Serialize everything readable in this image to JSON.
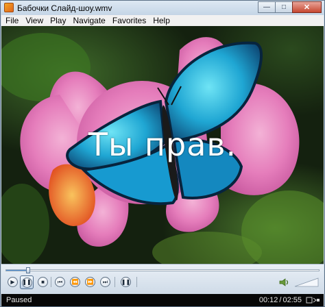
{
  "window": {
    "title": "Бабочки Слайд-шоу.wmv"
  },
  "menu": [
    "File",
    "View",
    "Play",
    "Navigate",
    "Favorites",
    "Help"
  ],
  "video": {
    "subtitle": "Ты прав."
  },
  "player": {
    "seek_progress_fraction": 0.07,
    "buttons": [
      "shuffle",
      "repeat",
      "stop",
      "previous",
      "rewind",
      "fast-forward",
      "next",
      "play-pause"
    ],
    "state_button": "pause",
    "volume_fraction": 0.0
  },
  "status": {
    "state": "Paused",
    "current_time": "00:12",
    "total_time": "02:55",
    "separator": "/"
  },
  "colors": {
    "status_bar": "#070707",
    "seek_fill": "#4a8bd0"
  }
}
